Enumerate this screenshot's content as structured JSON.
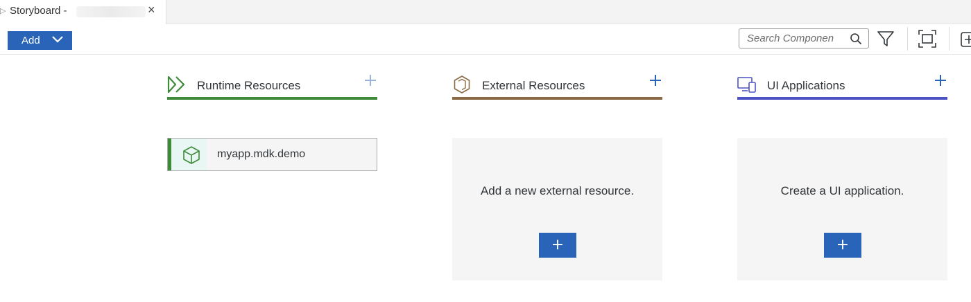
{
  "tab": {
    "title": "Storyboard -",
    "close_glyph": "×"
  },
  "toolbar": {
    "add_label": "Add",
    "search_placeholder": "Search Componen"
  },
  "columns": [
    {
      "title": "Runtime Resources",
      "icon": "runtime-icon",
      "accent": "#3f8a3a",
      "plus_color": "#9bb3d6"
    },
    {
      "title": "External Resources",
      "icon": "external-resource-icon",
      "accent": "#8a6a44",
      "plus_color": "#2a64b8"
    },
    {
      "title": "UI Applications",
      "icon": "ui-application-icon",
      "accent": "#4d52c4",
      "plus_color": "#2a64b8"
    }
  ],
  "runtime_items": [
    {
      "label": "myapp.mdk.demo",
      "icon": "cube-icon"
    }
  ],
  "external_empty": {
    "message": "Add a new external resource.",
    "button_label": "+"
  },
  "ui_empty": {
    "message": "Create a UI application.",
    "button_label": "+"
  }
}
